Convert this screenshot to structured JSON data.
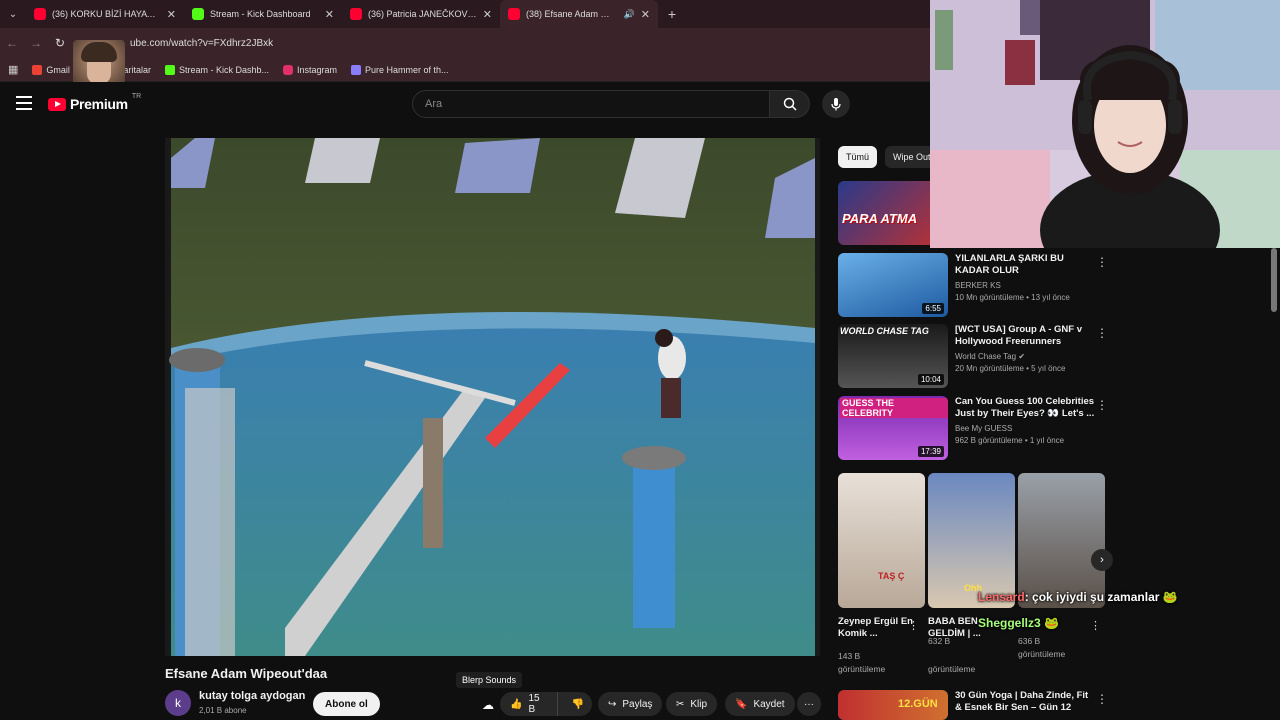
{
  "browser": {
    "tabs": [
      {
        "title": "(36) KORKU BİZİ HAYATTA TUTA",
        "icon": "youtube-icon",
        "active": false
      },
      {
        "title": "Stream - Kick Dashboard",
        "icon": "kick-icon",
        "active": false
      },
      {
        "title": "(36) Patricia JANEČKOVÁ: \"Les c",
        "icon": "youtube-icon",
        "active": false
      },
      {
        "title": "(38) Efsane Adam Wipeout'",
        "icon": "youtube-icon",
        "active": true
      }
    ],
    "new_tab": "+",
    "url": "ube.com/watch?v=FXdhrz2JBxk",
    "bookmarks": [
      {
        "label": "Gmail",
        "color": "#ea4335"
      },
      {
        "label": "e",
        "color": ""
      },
      {
        "label": "Haritalar",
        "color": "#34a853"
      },
      {
        "label": "Stream - Kick Dashb...",
        "color": "#53fc18"
      },
      {
        "label": "Instagram",
        "color": "#e1306c"
      },
      {
        "label": "Pure Hammer of th...",
        "color": "#8a7cff"
      }
    ]
  },
  "youtube": {
    "logo_text": "Premium",
    "country_code": "TR",
    "search_placeholder": "Ara",
    "video": {
      "title": "Efsane Adam Wipeout'daa",
      "channel_initial": "k",
      "channel_name": "kutay tolga aydogan",
      "subscribers": "2,01 B abone",
      "subscribe_label": "Abone ol",
      "tooltip": "Blerp Sounds",
      "likes": "15 B",
      "share_label": "Paylaş",
      "clip_label": "Klip",
      "save_label": "Kaydet",
      "more_label": "···"
    },
    "chips": [
      {
        "label": "Tümü",
        "active": true
      },
      {
        "label": "Wipe Out",
        "active": false
      }
    ],
    "recommendations": [
      {
        "title": "",
        "channel": "",
        "meta": "",
        "duration": "",
        "thumb_caption": "PARA ATMA"
      },
      {
        "title": "YILANLARLA ŞARKI BU KADAR OLUR",
        "channel": "BERKER KS",
        "meta": "10 Mn görüntüleme • 13 yıl önce",
        "duration": "6:55",
        "thumb_caption": ""
      },
      {
        "title": "[WCT USA] Group A - GNF v Hollywood Freerunners",
        "channel": "World Chase Tag",
        "verified": "✔",
        "meta": "20 Mn görüntüleme • 5 yıl önce",
        "duration": "10:04",
        "thumb_caption": "WORLD CHASE TAG"
      },
      {
        "title": "Can You Guess 100 Celebrities Just by Their Eyes? 👀 Let's ...",
        "channel": "Bee My GUESS",
        "meta": "962 B görüntüleme • 1 yıl önce",
        "duration": "17:39",
        "thumb_caption": "GUESS THE CELEBRITY"
      }
    ],
    "shorts": [
      {
        "title": "Zeynep Ergül En Komik ...",
        "views_line1": "143 B",
        "views_line2": "görüntüleme",
        "overlay": "TAŞ Ç"
      },
      {
        "title": "BABA BEN GELDİM | ...",
        "views_line1": "632 B",
        "views_line2": "görüntüleme",
        "overlay": "Ohh"
      },
      {
        "title": "",
        "views_line1": "636 B",
        "views_line2": "görüntüleme",
        "overlay": ""
      }
    ],
    "shorts_next": "›",
    "bottom_rec": {
      "title": "30 Gün Yoga | Daha Zinde, Fit & Esnek Bir Sen – Gün 12",
      "thumb_caption": "12.GÜN"
    }
  },
  "chat": [
    {
      "user": "Lensard",
      "message": ": çok iyiydi şu zamanlar 🐸"
    },
    {
      "user": "Sheggellz3",
      "message": "🐸"
    }
  ],
  "colors": {
    "yt_red": "#ff0033",
    "kick_green": "#53fc18",
    "bg": "#0f0f0f"
  }
}
